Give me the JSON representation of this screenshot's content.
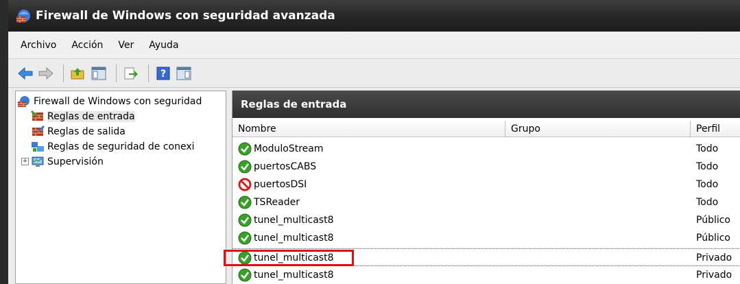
{
  "window": {
    "title": "Firewall de Windows con seguridad avanzada"
  },
  "menu": [
    "Archivo",
    "Acción",
    "Ver",
    "Ayuda"
  ],
  "tree": {
    "root": "Firewall de Windows con seguridad",
    "items": [
      {
        "label": "Reglas de entrada",
        "selected": true
      },
      {
        "label": "Reglas de salida"
      },
      {
        "label": "Reglas de seguridad de conexi"
      },
      {
        "label": "Supervisión",
        "expander": "+"
      }
    ]
  },
  "pane": {
    "title": "Reglas de entrada",
    "columns": [
      "Nombre",
      "Grupo",
      "Perfil"
    ],
    "rows": [
      {
        "name": "ModuloStream",
        "group": "",
        "profile": "Todo",
        "status": "allow"
      },
      {
        "name": "puertosCABS",
        "group": "",
        "profile": "Todo",
        "status": "allow"
      },
      {
        "name": "puertosDSI",
        "group": "",
        "profile": "Todo",
        "status": "block"
      },
      {
        "name": "TSReader",
        "group": "",
        "profile": "Todo",
        "status": "allow"
      },
      {
        "name": "tunel_multicast8",
        "group": "",
        "profile": "Público",
        "status": "allow"
      },
      {
        "name": "tunel_multicast8",
        "group": "",
        "profile": "Público",
        "status": "allow"
      },
      {
        "name": "tunel_multicast8",
        "group": "",
        "profile": "Privado",
        "status": "allow",
        "highlighted": true
      },
      {
        "name": "tunel_multicast8",
        "group": "",
        "profile": "Privado",
        "status": "allow"
      }
    ]
  },
  "colors": {
    "highlight": "#e01010",
    "allow": "#3aa02a",
    "block": "#d02020"
  }
}
